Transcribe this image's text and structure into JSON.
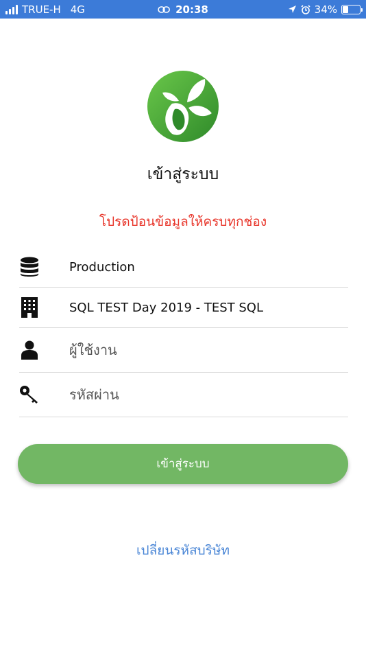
{
  "status_bar": {
    "carrier": "TRUE-H",
    "network": "4G",
    "time": "20:38",
    "battery_percent": "34%",
    "battery_level": 0.34,
    "icons": [
      "signal-icon",
      "link-icon",
      "location-arrow-icon",
      "alarm-icon",
      "battery-charging-icon"
    ]
  },
  "app": {
    "logo": "leaf-logo",
    "title": "เข้าสู่ระบบ",
    "error_message": "โปรดป้อนข้อมูลให้ครบทุกช่อง"
  },
  "form": {
    "database": {
      "icon": "database-icon",
      "value": "Production"
    },
    "company": {
      "icon": "building-icon",
      "value": "SQL TEST  Day 2019 - TEST SQL"
    },
    "username": {
      "icon": "user-icon",
      "placeholder": "ผู้ใช้งาน",
      "value": ""
    },
    "password": {
      "icon": "key-icon",
      "placeholder": "รหัสผ่าน",
      "value": ""
    }
  },
  "actions": {
    "login_label": "เข้าสู่ระบบ",
    "change_company_label": "เปลี่ยนรหัสบริษัท"
  },
  "colors": {
    "status_bar": "#3c7bd8",
    "button": "#72b764",
    "error": "#e8362b",
    "link": "#4a86d6"
  }
}
